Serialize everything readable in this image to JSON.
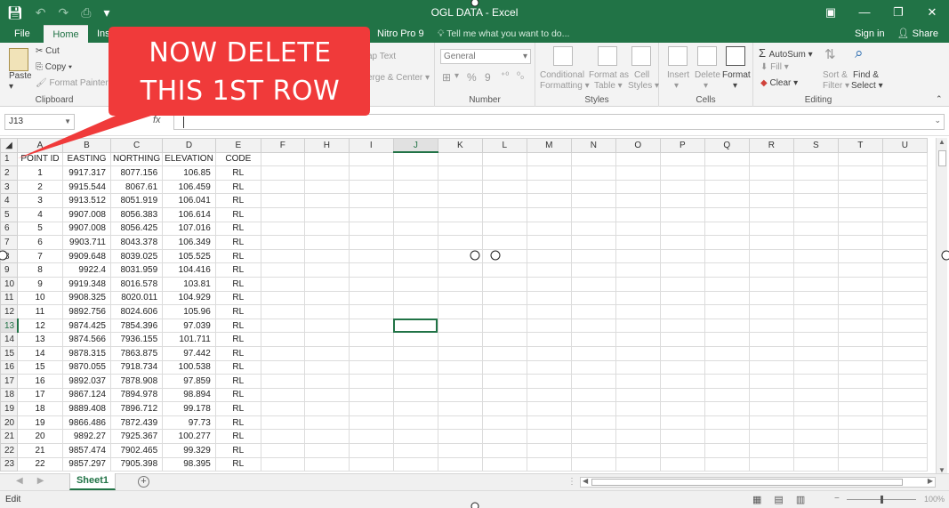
{
  "window": {
    "title": "OGL DATA - Excel",
    "controls": [
      "▣",
      "—",
      "❐",
      "✕"
    ]
  },
  "tabs": {
    "items": [
      "File",
      "Home",
      "Ins",
      "Nitro Pro 9"
    ],
    "active": "Home",
    "tell_me": "Tell me what you want to do...",
    "sign_in": "Sign in",
    "share": "Share"
  },
  "ribbon": {
    "clipboard": {
      "label": "Clipboard",
      "paste": "Paste",
      "cut": "Cut",
      "copy": "Copy",
      "format_painter": "Format Painter"
    },
    "alignment": {
      "wrap_text": "ap Text",
      "merge_center": "erge & Center"
    },
    "number": {
      "label": "Number",
      "format_value": "General",
      "percent": "%",
      "comma": "9"
    },
    "styles": {
      "label": "Styles",
      "conditional_1": "Conditional",
      "conditional_2": "Formatting",
      "format_as_1": "Format as",
      "format_as_2": "Table",
      "cell_styles_1": "Cell",
      "cell_styles_2": "Styles"
    },
    "cells": {
      "label": "Cells",
      "insert": "Insert",
      "delete": "Delete",
      "format": "Format"
    },
    "editing": {
      "label": "Editing",
      "autosum": "AutoSum",
      "fill": "Fill",
      "clear": "Clear",
      "sort_1": "Sort &",
      "sort_2": "Filter",
      "find_1": "Find &",
      "find_2": "Select"
    }
  },
  "formula_bar": {
    "name_box": "J13",
    "fx": "fx",
    "value": ""
  },
  "grid": {
    "columns": [
      "A",
      "B",
      "C",
      "D",
      "E",
      "F",
      "H",
      "I",
      "J",
      "K",
      "L",
      "M",
      "N",
      "O",
      "P",
      "Q",
      "R",
      "S",
      "T",
      "U"
    ],
    "selected_column": "J",
    "selected_row": 13,
    "header_row": [
      "POINT ID",
      "EASTING",
      "NORTHING",
      "ELEVATION",
      "CODE"
    ],
    "rows": [
      [
        "1",
        "9917.317",
        "8077.156",
        "106.85",
        "RL"
      ],
      [
        "2",
        "9915.544",
        "8067.61",
        "106.459",
        "RL"
      ],
      [
        "3",
        "9913.512",
        "8051.919",
        "106.041",
        "RL"
      ],
      [
        "4",
        "9907.008",
        "8056.383",
        "106.614",
        "RL"
      ],
      [
        "5",
        "9907.008",
        "8056.425",
        "107.016",
        "RL"
      ],
      [
        "6",
        "9903.711",
        "8043.378",
        "106.349",
        "RL"
      ],
      [
        "7",
        "9909.648",
        "8039.025",
        "105.525",
        "RL"
      ],
      [
        "8",
        "9922.4",
        "8031.959",
        "104.416",
        "RL"
      ],
      [
        "9",
        "9919.348",
        "8016.578",
        "103.81",
        "RL"
      ],
      [
        "10",
        "9908.325",
        "8020.011",
        "104.929",
        "RL"
      ],
      [
        "11",
        "9892.756",
        "8024.606",
        "105.96",
        "RL"
      ],
      [
        "12",
        "9874.425",
        "7854.396",
        "97.039",
        "RL"
      ],
      [
        "13",
        "9874.566",
        "7936.155",
        "101.711",
        "RL"
      ],
      [
        "14",
        "9878.315",
        "7863.875",
        "97.442",
        "RL"
      ],
      [
        "15",
        "9870.055",
        "7918.734",
        "100.538",
        "RL"
      ],
      [
        "16",
        "9892.037",
        "7878.908",
        "97.859",
        "RL"
      ],
      [
        "17",
        "9867.124",
        "7894.978",
        "98.894",
        "RL"
      ],
      [
        "18",
        "9889.408",
        "7896.712",
        "99.178",
        "RL"
      ],
      [
        "19",
        "9866.486",
        "7872.439",
        "97.73",
        "RL"
      ],
      [
        "20",
        "9892.27",
        "7925.367",
        "100.277",
        "RL"
      ],
      [
        "21",
        "9857.474",
        "7902.465",
        "99.329",
        "RL"
      ],
      [
        "22",
        "9857.297",
        "7905.398",
        "98.395",
        "RL"
      ]
    ]
  },
  "sheets": {
    "active": "Sheet1",
    "add_symbol": "⊕"
  },
  "status": {
    "mode": "Edit",
    "zoom": "100%"
  },
  "callout": {
    "line1": "NOW DELETE",
    "line2": "THIS 1ST ROW",
    "color": "#f03a3a"
  }
}
